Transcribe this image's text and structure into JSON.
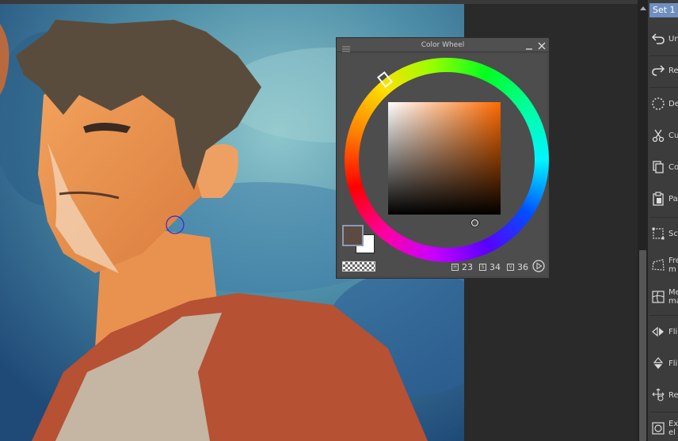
{
  "command_bar": {
    "set_tab": "Set 1",
    "items": [
      {
        "label": "Un",
        "icon": "undo-icon"
      },
      {
        "label": "Re",
        "icon": "redo-icon"
      },
      {
        "label": "De",
        "icon": "deselect-icon"
      },
      {
        "label": "Cu",
        "icon": "cut-icon"
      },
      {
        "label": "Co",
        "icon": "copy-icon"
      },
      {
        "label": "Pa",
        "icon": "paste-icon"
      },
      {
        "label": "Sc",
        "icon": "scale-icon"
      },
      {
        "label": "Fre\nm",
        "icon": "free-transform-icon"
      },
      {
        "label": "Me\nma",
        "icon": "mesh-transform-icon"
      },
      {
        "label": "Fli",
        "icon": "flip-horizontal-icon"
      },
      {
        "label": "Fli",
        "icon": "flip-vertical-icon"
      },
      {
        "label": "Re",
        "icon": "rotate-icon"
      },
      {
        "label": "Ex\nel",
        "icon": "expand-selection-icon"
      }
    ]
  },
  "color_wheel": {
    "title": "Color Wheel",
    "main_color": "#5c4b43",
    "sub_color": "#ffffff",
    "hue_color": "#ff6a00",
    "hsv": {
      "h": "23",
      "s": "34",
      "v": "36"
    }
  },
  "colors": {
    "panel_bg": "#4a4a4a",
    "selected_tab": "#6f8fbf",
    "command_bar_bg": "#3c3c3c"
  }
}
